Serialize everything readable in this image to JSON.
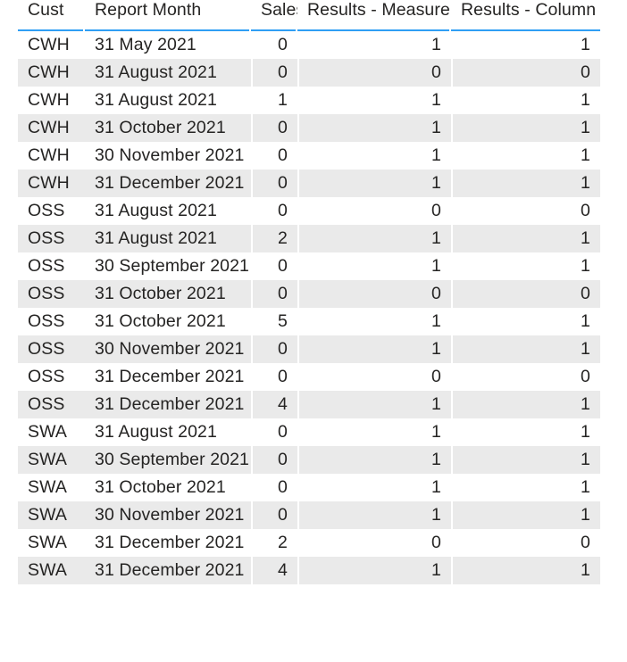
{
  "table": {
    "columns": [
      {
        "key": "cust",
        "label": "Cust",
        "align": "left"
      },
      {
        "key": "month",
        "label": "Report Month",
        "align": "left"
      },
      {
        "key": "sales",
        "label": "Sales",
        "align": "right"
      },
      {
        "key": "measure",
        "label": "Results - Measure",
        "align": "right"
      },
      {
        "key": "column",
        "label": "Results - Column",
        "align": "right"
      }
    ],
    "header_rule_color": "#2f9ef4",
    "band_color": "#eaeaea",
    "text_color": "#252423",
    "rows": [
      {
        "cust": "CWH",
        "month": "31 May 2021",
        "sales": "0",
        "measure": "1",
        "column": "1"
      },
      {
        "cust": "CWH",
        "month": "31 August 2021",
        "sales": "0",
        "measure": "0",
        "column": "0"
      },
      {
        "cust": "CWH",
        "month": "31 August 2021",
        "sales": "1",
        "measure": "1",
        "column": "1"
      },
      {
        "cust": "CWH",
        "month": "31 October 2021",
        "sales": "0",
        "measure": "1",
        "column": "1"
      },
      {
        "cust": "CWH",
        "month": "30 November 2021",
        "sales": "0",
        "measure": "1",
        "column": "1"
      },
      {
        "cust": "CWH",
        "month": "31 December 2021",
        "sales": "0",
        "measure": "1",
        "column": "1"
      },
      {
        "cust": "OSS",
        "month": "31 August 2021",
        "sales": "0",
        "measure": "0",
        "column": "0"
      },
      {
        "cust": "OSS",
        "month": "31 August 2021",
        "sales": "2",
        "measure": "1",
        "column": "1"
      },
      {
        "cust": "OSS",
        "month": "30 September 2021",
        "sales": "0",
        "measure": "1",
        "column": "1"
      },
      {
        "cust": "OSS",
        "month": "31 October 2021",
        "sales": "0",
        "measure": "0",
        "column": "0"
      },
      {
        "cust": "OSS",
        "month": "31 October 2021",
        "sales": "5",
        "measure": "1",
        "column": "1"
      },
      {
        "cust": "OSS",
        "month": "30 November 2021",
        "sales": "0",
        "measure": "1",
        "column": "1"
      },
      {
        "cust": "OSS",
        "month": "31 December 2021",
        "sales": "0",
        "measure": "0",
        "column": "0"
      },
      {
        "cust": "OSS",
        "month": "31 December 2021",
        "sales": "4",
        "measure": "1",
        "column": "1"
      },
      {
        "cust": "SWA",
        "month": "31 August 2021",
        "sales": "0",
        "measure": "1",
        "column": "1"
      },
      {
        "cust": "SWA",
        "month": "30 September 2021",
        "sales": "0",
        "measure": "1",
        "column": "1"
      },
      {
        "cust": "SWA",
        "month": "31 October 2021",
        "sales": "0",
        "measure": "1",
        "column": "1"
      },
      {
        "cust": "SWA",
        "month": "30 November 2021",
        "sales": "0",
        "measure": "1",
        "column": "1"
      },
      {
        "cust": "SWA",
        "month": "31 December 2021",
        "sales": "2",
        "measure": "0",
        "column": "0"
      },
      {
        "cust": "SWA",
        "month": "31 December 2021",
        "sales": "4",
        "measure": "1",
        "column": "1"
      }
    ]
  }
}
